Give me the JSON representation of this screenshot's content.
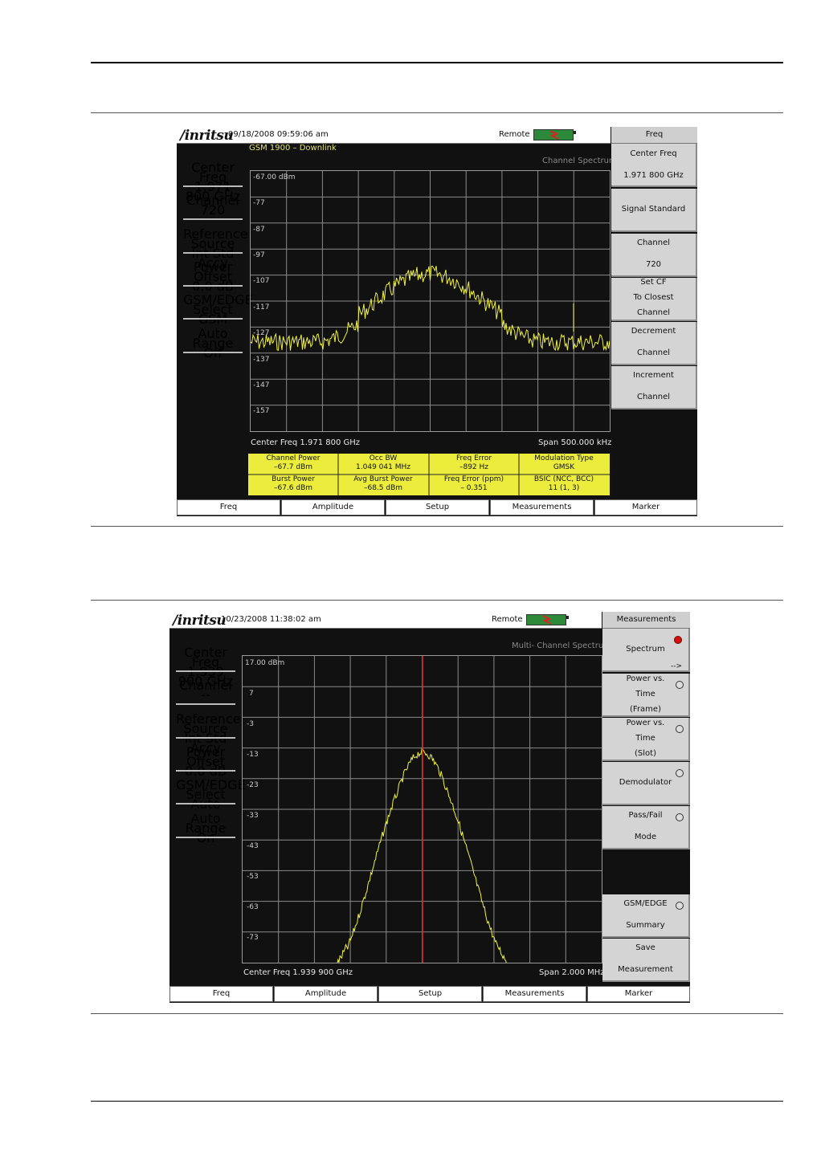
{
  "screen1": {
    "logo": "/inritsu",
    "datetime": "09/18/2008 09:59:06 am",
    "remote": "Remote",
    "menu_title": "Freq",
    "signal_label": "GSM 1900 – Downlink",
    "mode_label": "Channel Spectrum",
    "ref_level": "-67.00 dBm",
    "y_labels": [
      "-77",
      "-87",
      "-97",
      "-107",
      "-117",
      "-127",
      "-137",
      "-147",
      "-157"
    ],
    "center_freq_text": "Center Freq 1.971 800 GHz",
    "span_text": "Span 500.000 kHz",
    "params": [
      {
        "label": "Center Freq",
        "value": "1.971 800 GHz"
      },
      {
        "label": "Channel",
        "value": "720"
      },
      {
        "label": "Reference Source",
        "value": "Int Std Accy"
      },
      {
        "label": "Power Offset",
        "value": "0.0 dB"
      },
      {
        "label": "GSM/EDGE Select",
        "value": "GSM"
      },
      {
        "label": "Auto Range",
        "value": "Off"
      }
    ],
    "softkeys": [
      {
        "line1": "Center Freq",
        "line2": "",
        "line3": "1.971 800 GHz"
      },
      {
        "line1": "",
        "line2": "Signal Standard",
        "line3": ""
      },
      {
        "line1": "Channel",
        "line2": "",
        "line3": "720"
      },
      {
        "line1": "Set CF",
        "line2": "To Closest",
        "line3": "Channel"
      },
      {
        "line1": "Decrement",
        "line2": "",
        "line3": "Channel"
      },
      {
        "line1": "Increment",
        "line2": "",
        "line3": "Channel"
      }
    ],
    "results": [
      {
        "label": "Channel Power",
        "value": "–67.7 dBm"
      },
      {
        "label": "Occ BW",
        "value": "1.049 041 MHz"
      },
      {
        "label": "Freq Error",
        "value": "–892 Hz"
      },
      {
        "label": "Modulation Type",
        "value": "GMSK"
      },
      {
        "label": "Burst Power",
        "value": "–67.6 dBm"
      },
      {
        "label": "Avg Burst Power",
        "value": "–68.5 dBm"
      },
      {
        "label": "Freq Error (ppm)",
        "value": "– 0.351"
      },
      {
        "label": "BSIC (NCC, BCC)",
        "value": "11 (1, 3)"
      }
    ],
    "tabs": [
      "Freq",
      "Amplitude",
      "Setup",
      "Measurements",
      "Marker"
    ],
    "trace_color": "#f0f040"
  },
  "screen2": {
    "logo": "/inritsu",
    "datetime": "10/23/2008 11:38:02 am",
    "remote": "Remote",
    "menu_title": "Measurements",
    "mode_label": "Multi- Channel Spectrum",
    "ref_level": "17.00 dBm",
    "y_labels": [
      "7",
      "-3",
      "-13",
      "-23",
      "-33",
      "-43",
      "-53",
      "-63",
      "-73"
    ],
    "center_freq_text": "Center Freq 1.939 900 GHz",
    "span_text": "Span 2.000 MHz",
    "params": [
      {
        "label": "Center Freq",
        "value": "1.939 900 GHz"
      },
      {
        "label": "Channel",
        "value": "--"
      },
      {
        "label": "Reference Source",
        "value": "Int Std Accy"
      },
      {
        "label": "Power Offset",
        "value": "0.0 dB"
      },
      {
        "label": "GSM/EDGE Select",
        "value": "Auto"
      },
      {
        "label": "Auto Range",
        "value": "On"
      }
    ],
    "softkeys": [
      {
        "line1": "",
        "line2": "Spectrum",
        "line3": "",
        "arrow": "-->"
      },
      {
        "line1": "Power vs.",
        "line2": "Time",
        "line3": "(Frame)"
      },
      {
        "line1": "Power vs.",
        "line2": "Time",
        "line3": "(Slot)"
      },
      {
        "line1": "",
        "line2": "Demodulator",
        "line3": ""
      },
      {
        "line1": "Pass/Fail",
        "line2": "",
        "line3": "Mode"
      },
      {
        "line1": "GSM/EDGE",
        "line2": "",
        "line3": "Summary"
      },
      {
        "line1": "Save",
        "line2": "",
        "line3": "Measurement"
      }
    ],
    "tabs": [
      "Freq",
      "Amplitude",
      "Setup",
      "Measurements",
      "Marker"
    ],
    "trace_color": "#f0f040",
    "marker_color": "#e02020"
  }
}
